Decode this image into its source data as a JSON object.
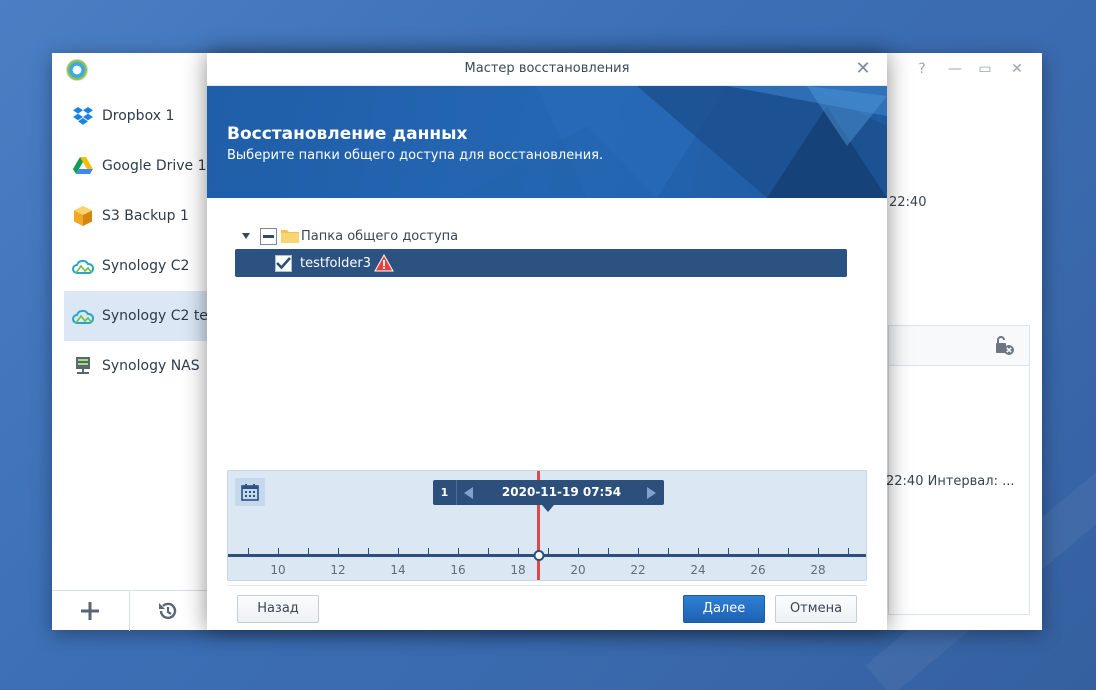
{
  "sidebar": {
    "items": [
      {
        "label": "Dropbox 1",
        "icon": "dropbox-icon"
      },
      {
        "label": "Google Drive 1",
        "icon": "google-drive-icon"
      },
      {
        "label": "S3 Backup 1",
        "icon": "s3-icon"
      },
      {
        "label": "Synology C2",
        "icon": "synology-c2-icon"
      },
      {
        "label": "Synology C2 te",
        "icon": "synology-c2-icon"
      },
      {
        "label": "Synology NAS",
        "icon": "nas-icon"
      }
    ],
    "add_icon": "plus-icon",
    "restore_icon": "history-icon"
  },
  "background_window": {
    "time_text_1": "22:40",
    "time_text_2": "22:40 Интервал: ..."
  },
  "modal": {
    "title": "Мастер восстановления",
    "banner_title": "Восстановление данных",
    "banner_subtitle": "Выберите папки общего доступа для восстановления.",
    "tree": {
      "root_label": "Папка общего доступа",
      "items": [
        {
          "label": "testfolder3",
          "checked": true,
          "warning": true
        }
      ]
    },
    "timeline": {
      "version_count": "1",
      "selected_datetime": "2020-11-19 07:54",
      "day_labels": [
        "10",
        "12",
        "14",
        "16",
        "18",
        "20",
        "22",
        "24",
        "26",
        "28"
      ]
    },
    "buttons": {
      "back": "Назад",
      "next": "Далее",
      "cancel": "Отмена"
    }
  },
  "colors": {
    "accent": "#2c5282",
    "primary_button": "#1d62b3",
    "banner": "#1f5ea8",
    "timeline_marker": "#e04848"
  }
}
